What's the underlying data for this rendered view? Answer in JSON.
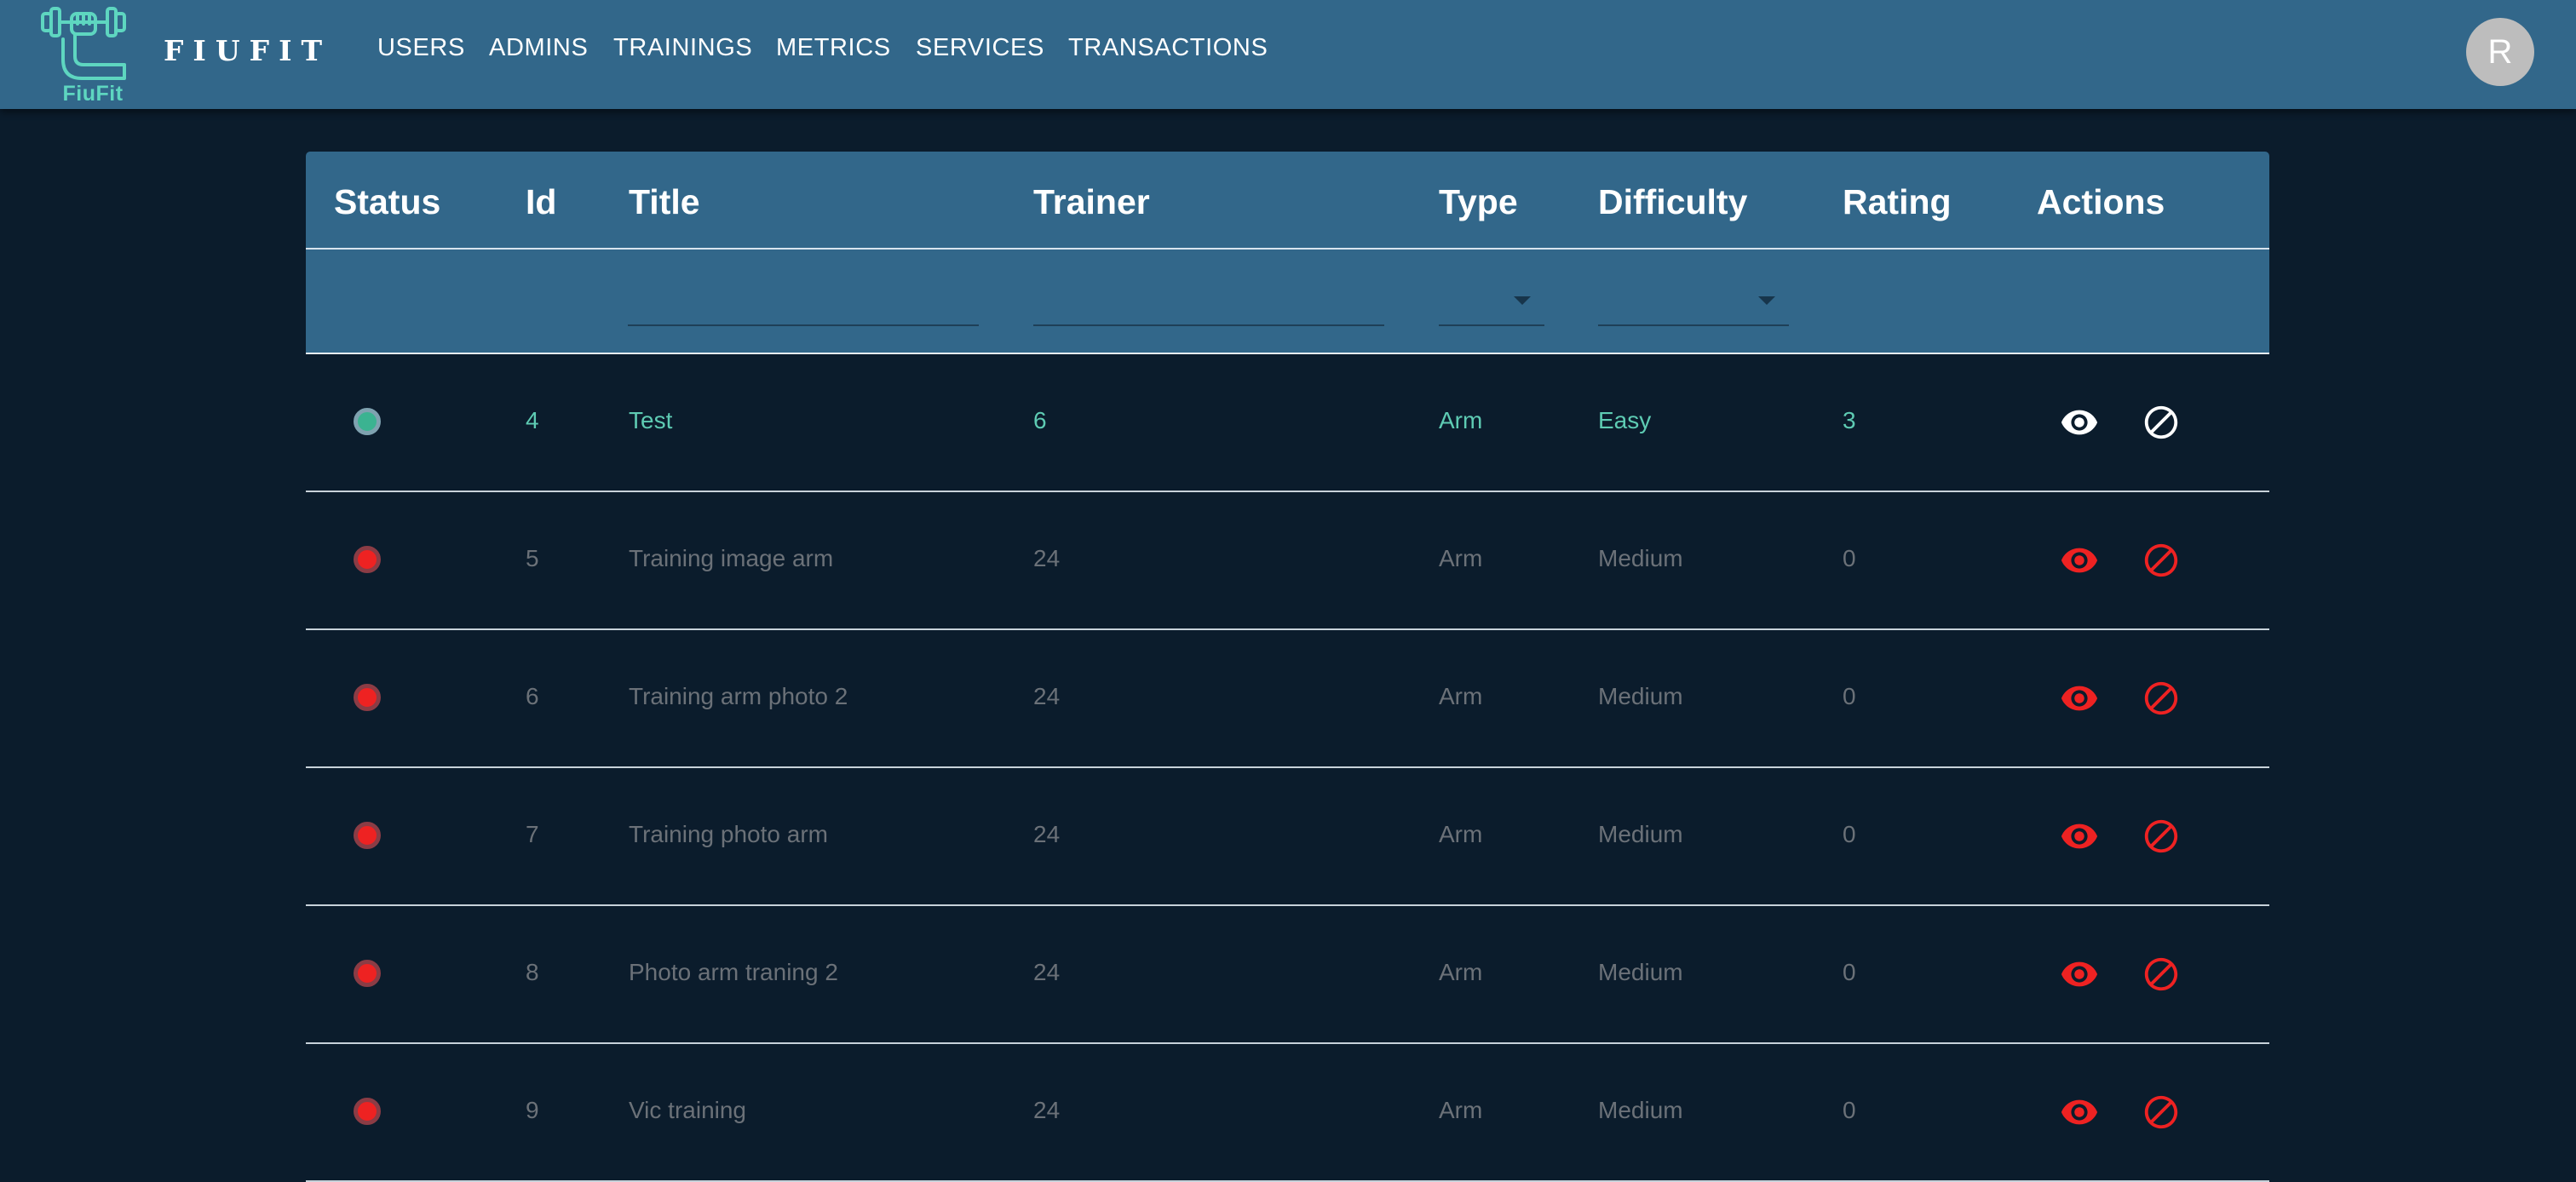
{
  "app": {
    "logo_text": "FiuFit",
    "brand": "FIUFIT",
    "avatar_initial": "R"
  },
  "nav": {
    "items": [
      "USERS",
      "ADMINS",
      "TRAININGS",
      "METRICS",
      "SERVICES",
      "TRANSACTIONS"
    ]
  },
  "table": {
    "columns": {
      "status": "Status",
      "id": "Id",
      "title": "Title",
      "trainer": "Trainer",
      "type": "Type",
      "difficulty": "Difficulty",
      "rating": "Rating",
      "actions": "Actions"
    },
    "filters": {
      "title_value": "",
      "trainer_value": "",
      "type_selected": "",
      "difficulty_selected": ""
    },
    "rows": [
      {
        "status": "active",
        "id": "4",
        "title": "Test",
        "trainer": "6",
        "type": "Arm",
        "difficulty": "Easy",
        "rating": "3"
      },
      {
        "status": "blocked",
        "id": "5",
        "title": "Training image arm",
        "trainer": "24",
        "type": "Arm",
        "difficulty": "Medium",
        "rating": "0"
      },
      {
        "status": "blocked",
        "id": "6",
        "title": "Training arm photo 2",
        "trainer": "24",
        "type": "Arm",
        "difficulty": "Medium",
        "rating": "0"
      },
      {
        "status": "blocked",
        "id": "7",
        "title": "Training photo arm",
        "trainer": "24",
        "type": "Arm",
        "difficulty": "Medium",
        "rating": "0"
      },
      {
        "status": "blocked",
        "id": "8",
        "title": "Photo arm traning 2",
        "trainer": "24",
        "type": "Arm",
        "difficulty": "Medium",
        "rating": "0"
      },
      {
        "status": "blocked",
        "id": "9",
        "title": "Vic training",
        "trainer": "24",
        "type": "Arm",
        "difficulty": "Medium",
        "rating": "0"
      }
    ]
  },
  "icons": {
    "view": "eye-icon",
    "block": "block-icon",
    "status": "status-dot-icon"
  },
  "colors": {
    "topbar": "#32678a",
    "background": "#0b1c2c",
    "active_text": "#5ecbb3",
    "active_dot": "#3bb391",
    "inactive_text": "#6b7178",
    "blocked": "#ee2222",
    "brand_teal": "#5ed6c0"
  }
}
